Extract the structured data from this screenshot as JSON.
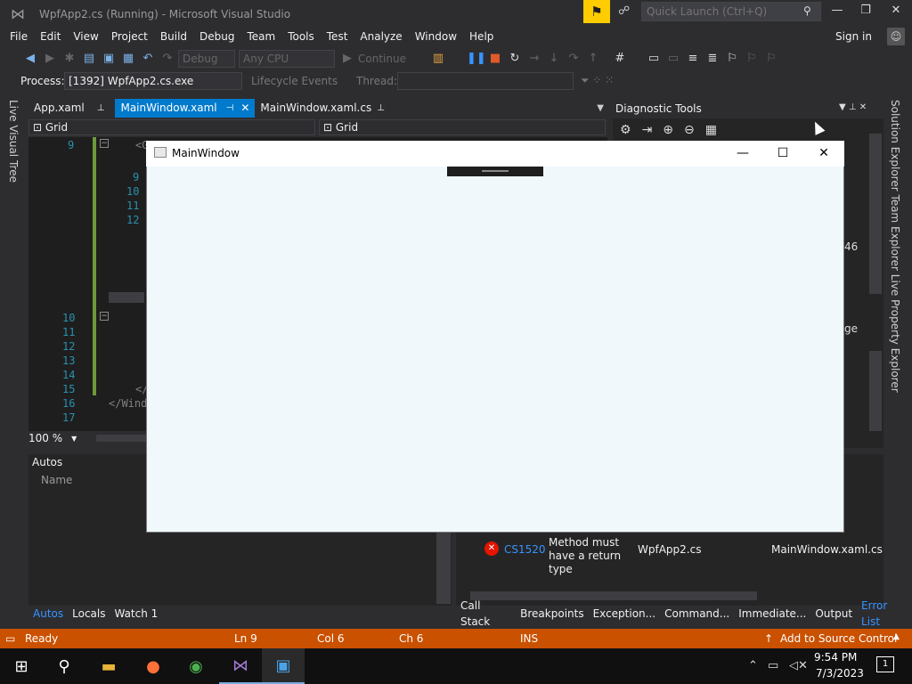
{
  "titlebar": {
    "title": "WpfApp2.cs (Running) - Microsoft Visual Studio",
    "quick_launch_placeholder": "Quick Launch (Ctrl+Q)",
    "minimize": "—",
    "maximize": "❐",
    "close": "✕"
  },
  "menu": {
    "items": [
      "File",
      "Edit",
      "View",
      "Project",
      "Build",
      "Debug",
      "Team",
      "Tools",
      "Test",
      "Analyze",
      "Window",
      "Help"
    ],
    "sign_in": "Sign in"
  },
  "toolbar": {
    "config": "Debug",
    "platform": "Any CPU",
    "continue": "Continue"
  },
  "processbar": {
    "process_label": "Process:",
    "process_value": "[1392] WpfApp2.cs.exe",
    "lifecycle": "Lifecycle Events",
    "thread_label": "Thread:"
  },
  "left_vtab": "Live Visual Tree",
  "editor": {
    "tabs": [
      {
        "label": "App.xaml",
        "icon": "⊕"
      },
      {
        "label": "MainWindow.xaml",
        "icon": "⊕ ✕"
      },
      {
        "label": "MainWindow.xaml.cs",
        "icon": "⊕"
      }
    ],
    "nav_left": "Grid",
    "nav_right": "Grid",
    "line_numbers_outer": [
      "9"
    ],
    "line_numbers_inner": [
      "9",
      "10",
      "11",
      "12"
    ],
    "line_numbers_lower": [
      "10",
      "11",
      "12",
      "13",
      "14",
      "15",
      "16",
      "17"
    ],
    "code_fragment_1": "<G",
    "code_fragment_2": "</",
    "code_fragment_3": "</Wind",
    "zoom": "100 %"
  },
  "autos": {
    "title": "Autos",
    "name_column": "Name"
  },
  "bottom_left_tabs": [
    "Autos",
    "Locals",
    "Watch 1"
  ],
  "diagnostic": {
    "title": "Diagnostic Tools",
    "partial_value": "46",
    "partial_label": "ge"
  },
  "right_vtabs": "Solution Explorer   Team Explorer   Live Property Explorer",
  "error_list": {
    "code": "CS1520",
    "description": "Method must have a return type",
    "project": "WpfApp2.cs",
    "file": "MainWindow.xaml.cs"
  },
  "bottom_right_tabs": [
    "Call Stack",
    "Breakpoints",
    "Exception...",
    "Command...",
    "Immediate...",
    "Output",
    "Error List"
  ],
  "statusbar": {
    "ready": "Ready",
    "ln": "Ln 9",
    "col": "Col 6",
    "ch": "Ch 6",
    "ins": "INS",
    "source_control": "Add to Source Control"
  },
  "taskbar": {
    "time": "9:54 PM",
    "date": "7/3/2023",
    "notification_count": "1"
  },
  "wpf_window": {
    "title": "MainWindow",
    "minimize": "—",
    "maximize": "☐",
    "close": "✕"
  },
  "colors": {
    "accent": "#007acc",
    "status_bar": "#ca5100",
    "notification": "#ffcc00",
    "error": "#e51400"
  }
}
